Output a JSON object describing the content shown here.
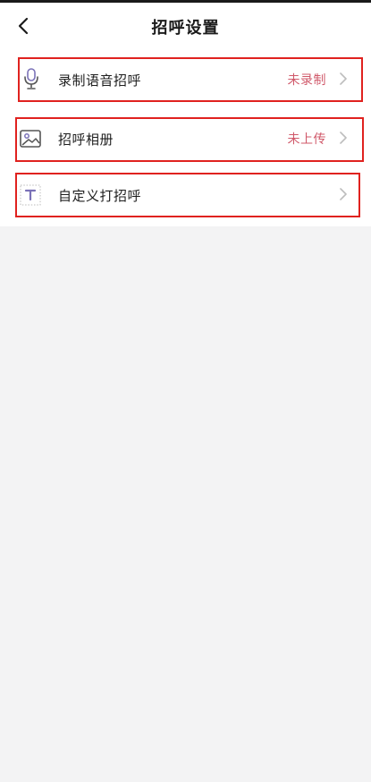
{
  "header": {
    "title": "招呼设置",
    "back_icon": "chevron-left-icon"
  },
  "rows": [
    {
      "label": "录制语音招呼",
      "status": "未录制",
      "icon": "microphone-icon"
    },
    {
      "label": "招呼相册",
      "status": "未上传",
      "icon": "image-icon"
    },
    {
      "label": "自定义打招呼",
      "status": "",
      "icon": "text-t-icon"
    }
  ],
  "colors": {
    "status": "#d0596a",
    "highlight_border": "#e0221f",
    "icon_accent": "#7b72b8",
    "chevron": "#bdbdbd",
    "background": "#f3f3f4"
  }
}
